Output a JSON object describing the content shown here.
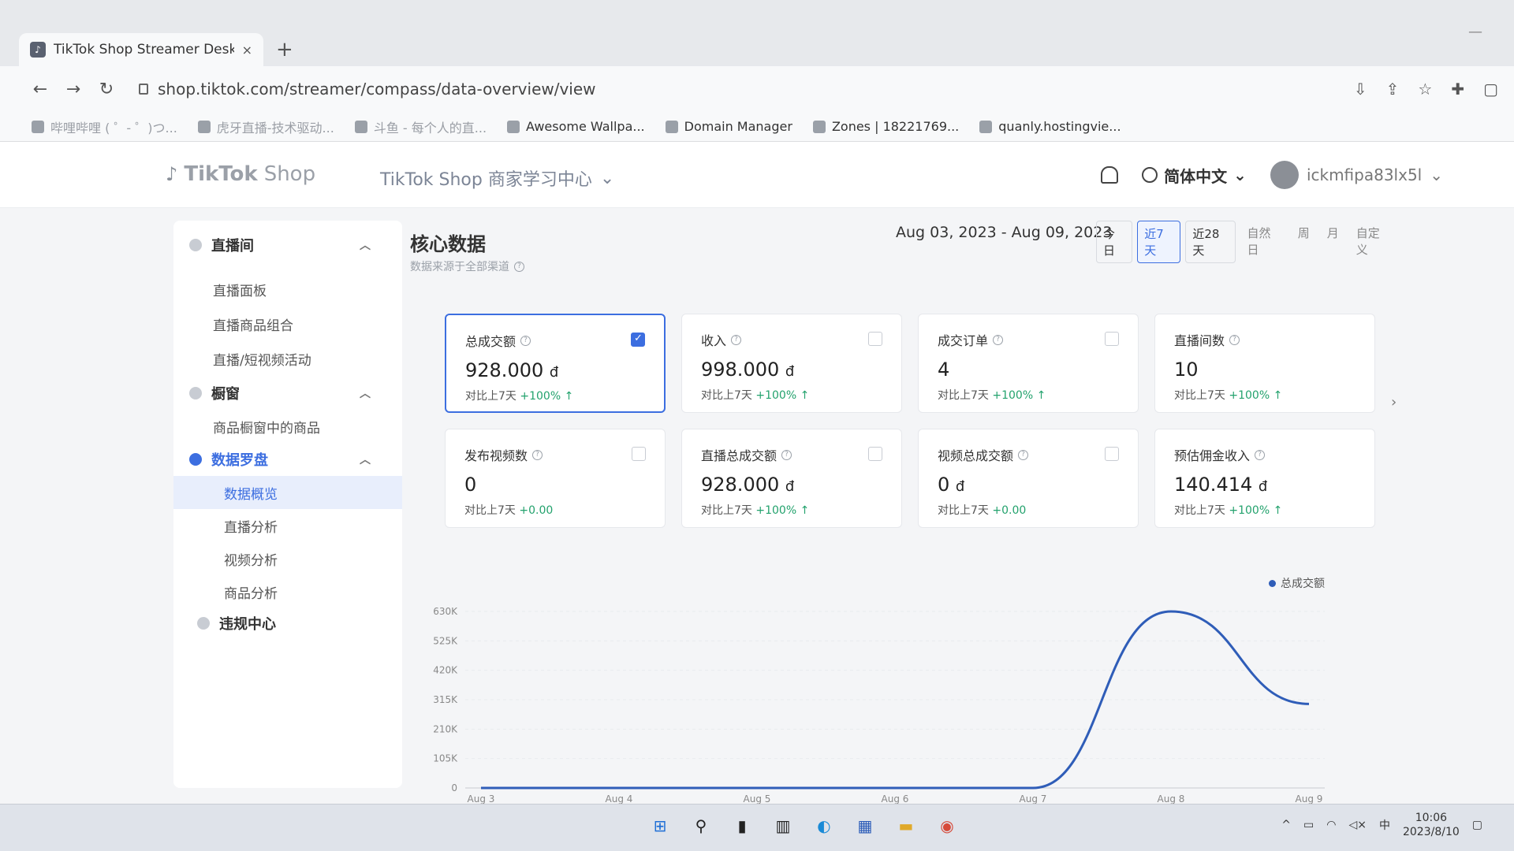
{
  "browser": {
    "tab_title": "TikTok Shop Streamer Desktop",
    "tab_close": "×",
    "new_tab": "+",
    "url": "shop.tiktok.com/streamer/compass/data-overview/view",
    "bookmarks": [
      {
        "label": "哔哩哔哩 ( ゜- ゜)つ...",
        "faded": true
      },
      {
        "label": "虎牙直播-技术驱动...",
        "faded": true
      },
      {
        "label": "斗鱼 - 每个人的直...",
        "faded": true
      },
      {
        "label": "Awesome Wallpa...",
        "faded": false
      },
      {
        "label": "Domain Manager",
        "faded": false
      },
      {
        "label": "Zones | 18221769...",
        "faded": false
      },
      {
        "label": "quanly.hostingvie...",
        "faded": false
      }
    ]
  },
  "header": {
    "logo_text": "TikTok",
    "logo_shop": "Shop",
    "center_title": "TikTok Shop 商家学习中心",
    "language": "简体中文",
    "username": "ickmfipa83lx5l"
  },
  "sidebar": {
    "groups": [
      {
        "label": "直播间",
        "items": [
          "直播面板",
          "直播商品组合",
          "直播/短视频活动"
        ]
      },
      {
        "label": "橱窗",
        "items": [
          "商品橱窗中的商品"
        ]
      },
      {
        "label": "数据罗盘",
        "items": [
          "数据概览",
          "直播分析",
          "视频分析",
          "商品分析"
        ]
      },
      {
        "label": "违规中心",
        "items": []
      }
    ]
  },
  "main": {
    "title": "核心数据",
    "subtitle": "数据来源于全部渠道",
    "date_range": "Aug 03, 2023 - Aug 09, 2023",
    "periods": [
      "今日",
      "近7天",
      "近28天",
      "自然日",
      "周",
      "月",
      "自定义"
    ],
    "active_period": "近7天",
    "cards": [
      {
        "label": "总成交额",
        "value": "928.000",
        "unit": "đ",
        "compare": "对比上7天",
        "delta": "+100%",
        "up": true,
        "checked": true
      },
      {
        "label": "收入",
        "value": "998.000",
        "unit": "đ",
        "compare": "对比上7天",
        "delta": "+100%",
        "up": true,
        "checked": false
      },
      {
        "label": "成交订单",
        "value": "4",
        "unit": "",
        "compare": "对比上7天",
        "delta": "+100%",
        "up": true,
        "checked": false
      },
      {
        "label": "直播间数",
        "value": "10",
        "unit": "",
        "compare": "对比上7天",
        "delta": "+100%",
        "up": true,
        "checked": null
      },
      {
        "label": "发布视频数",
        "value": "0",
        "unit": "",
        "compare": "对比上7天",
        "delta": "+0.00",
        "up": false,
        "checked": false
      },
      {
        "label": "直播总成交额",
        "value": "928.000",
        "unit": "đ",
        "compare": "对比上7天",
        "delta": "+100%",
        "up": true,
        "checked": false
      },
      {
        "label": "视频总成交额",
        "value": "0",
        "unit": "đ",
        "compare": "对比上7天",
        "delta": "+0.00",
        "up": false,
        "checked": false
      },
      {
        "label": "预估佣金收入",
        "value": "140.414",
        "unit": "đ",
        "compare": "对比上7天",
        "delta": "+100%",
        "up": true,
        "checked": null
      }
    ]
  },
  "chart_data": {
    "type": "line",
    "x": [
      "Aug 3",
      "Aug 4",
      "Aug 5",
      "Aug 6",
      "Aug 7",
      "Aug 8",
      "Aug 9"
    ],
    "series": [
      {
        "name": "总成交额",
        "values": [
          0,
          0,
          0,
          0,
          0,
          630000,
          300000
        ],
        "color": "#2f5db8"
      }
    ],
    "yticks": [
      "0",
      "105K",
      "210K",
      "315K",
      "420K",
      "525K",
      "630K"
    ],
    "ylim": [
      0,
      630000
    ],
    "grid": true,
    "legend": "top-right"
  },
  "taskbar": {
    "time": "10:06",
    "date": "2023/8/10",
    "ime": "中"
  }
}
